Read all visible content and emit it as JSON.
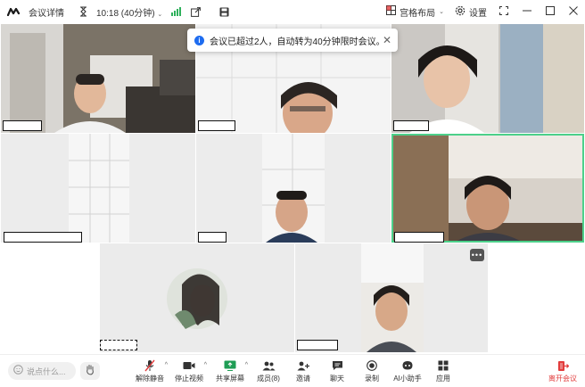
{
  "topbar": {
    "meeting_details": "会议详情",
    "timer": "10:18 (40分钟)",
    "grid_layout": "宫格布局",
    "settings": "设置"
  },
  "toast": {
    "message": "会议已超过2人，自动转为40分钟限时会议。"
  },
  "bottombar": {
    "chat_placeholder": "说点什么...",
    "tools": {
      "unmute": "解除静音",
      "stop_video": "停止视频",
      "share_screen": "共享屏幕",
      "members": "成员(8)",
      "invite": "邀请",
      "chat": "聊天",
      "record": "录制",
      "ai_assistant": "AI小助手",
      "apps": "应用",
      "leave": "离开会议"
    }
  },
  "colors": {
    "active_speaker_border": "#4cd08a",
    "leave_red": "#e23c3c",
    "info_blue": "#1e6cf0",
    "signal_green": "#2fb15c",
    "share_green": "#1f9d55"
  },
  "icons": {
    "logo": "tencent-meeting-logo-icon",
    "timer": "hourglass-icon",
    "signal": "signal-bars-icon",
    "popout": "popout-icon",
    "save": "save-icon",
    "grid": "grid-layout-icon",
    "settings": "gear-icon",
    "fullscreen": "fullscreen-icon"
  }
}
